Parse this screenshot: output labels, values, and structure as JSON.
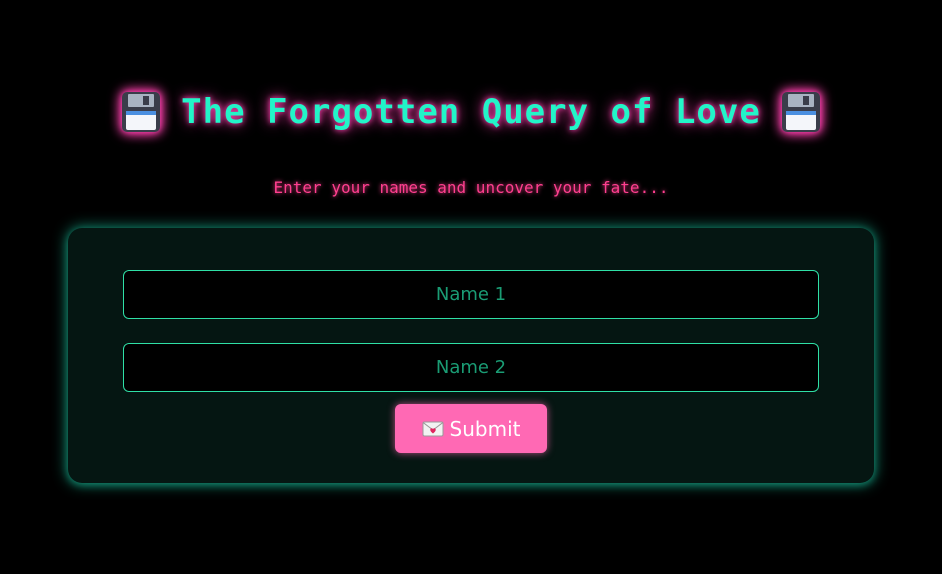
{
  "header": {
    "title": "The Forgotten Query of Love",
    "left_icon": "floppy-disk-icon",
    "right_icon": "floppy-disk-icon",
    "subtitle": "Enter your names and uncover your fate..."
  },
  "form": {
    "name1": {
      "placeholder": "Name 1",
      "value": ""
    },
    "name2": {
      "placeholder": "Name 2",
      "value": ""
    },
    "submit": {
      "icon": "love-letter-icon",
      "label": "Submit"
    }
  },
  "colors": {
    "background": "#000000",
    "title": "#22f5c8",
    "glow_pink": "#ff3fae",
    "subtitle": "#ff3f8f",
    "card_bg": "#051612",
    "field_border": "#2fe0a6",
    "button_bg": "#ff69b4"
  }
}
